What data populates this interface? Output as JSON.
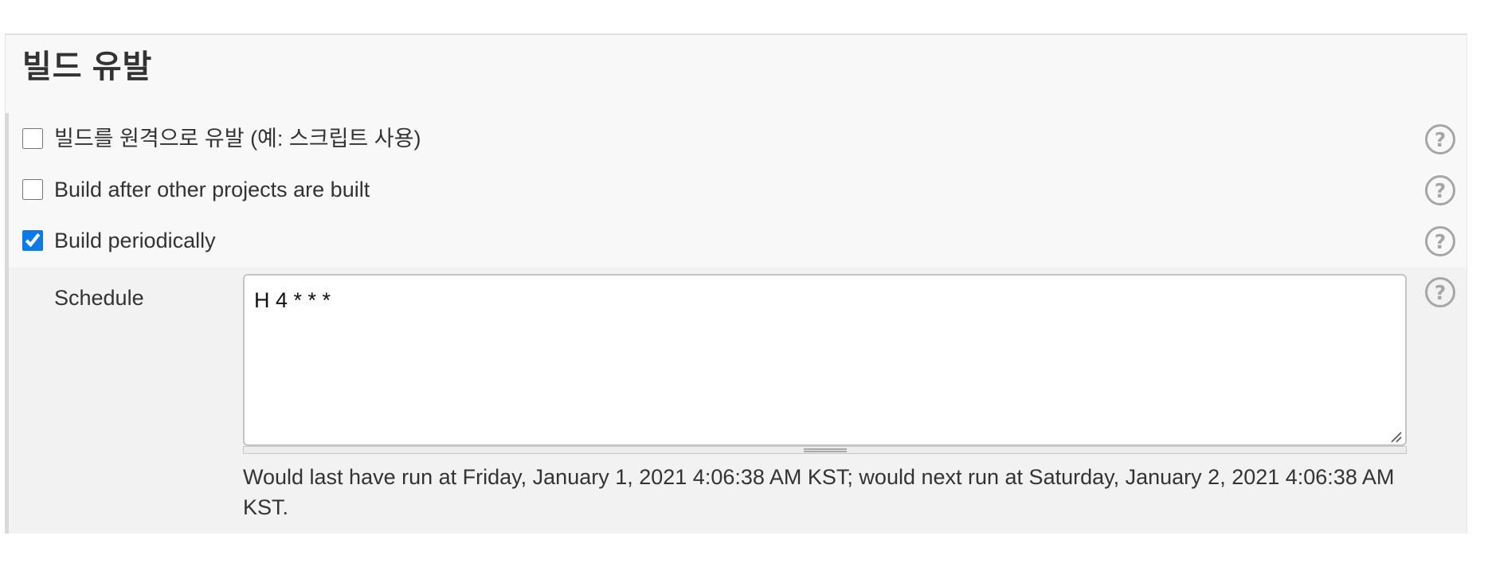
{
  "section": {
    "title": "빌드 유발"
  },
  "options": [
    {
      "label": "빌드를 원격으로 유발 (예: 스크립트 사용)",
      "checked": false
    },
    {
      "label": "Build after other projects are built",
      "checked": false
    },
    {
      "label": "Build periodically",
      "checked": true
    }
  ],
  "schedule": {
    "label": "Schedule",
    "value": "H 4 * * *",
    "note": "Would last have run at Friday, January 1, 2021 4:06:38 AM KST; would next run at Saturday, January 2, 2021 4:06:38 AM KST."
  },
  "help": {
    "glyph": "?"
  },
  "colors": {
    "accent": "#0b79e8",
    "help_icon": "#a6a6a6"
  }
}
